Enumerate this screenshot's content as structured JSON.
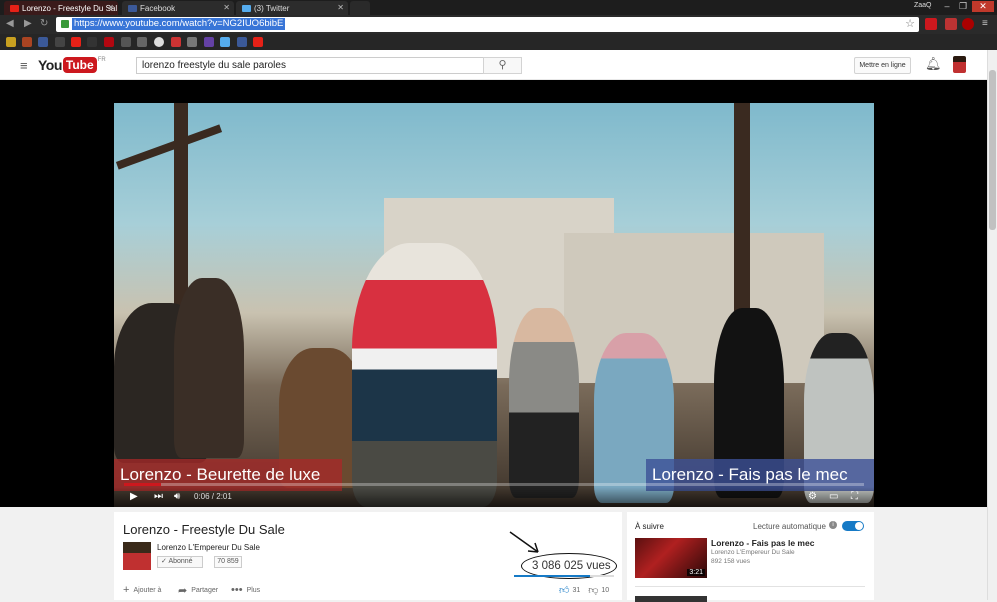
{
  "browser": {
    "tabs": [
      {
        "title": "Lorenzo - Freestyle Du Sal",
        "favicon_color": "#e62117"
      },
      {
        "title": "Facebook",
        "favicon_color": "#3b5998"
      },
      {
        "title": "(3) Twitter",
        "favicon_color": "#55acee"
      }
    ],
    "profile_name": "ZaaQ",
    "url": "https://www.youtube.com/watch?v=NG2IUO6bibE",
    "window_controls": {
      "minimize": "–",
      "restore": "❐",
      "close": "✕"
    }
  },
  "youtube": {
    "logo_you": "You",
    "logo_tube": "Tube",
    "logo_region": "FR",
    "search_query": "lorenzo freestyle du sale paroles",
    "upload_label": "Mettre en ligne"
  },
  "player": {
    "endcard_left": "Lorenzo - Beurette de luxe",
    "endcard_right": "Lorenzo - Fais pas le mec",
    "time": "0:06 / 2:01",
    "progress": 0.05
  },
  "video": {
    "title": "Lorenzo - Freestyle Du Sale",
    "channel": "Lorenzo L'Empereur Du Sale",
    "subscribe_label": "Abonné",
    "subscriber_count": "70 859",
    "views": "3 086 025 vues",
    "like_ratio": 0.76,
    "likes": "31",
    "dislikes": "10",
    "actions": {
      "add": "Ajouter à",
      "share": "Partager",
      "more": "Plus"
    }
  },
  "sidebar": {
    "up_next_label": "À suivre",
    "autoplay_label": "Lecture automatique",
    "autoplay_on": true,
    "next_video": {
      "title": "Lorenzo - Fais pas le mec",
      "channel": "Lorenzo L'Empereur Du Sale",
      "views": "892 158 vues",
      "duration": "3:21"
    }
  },
  "colors": {
    "youtube_red": "#cc181e",
    "link_blue": "#167ac6",
    "url_highlight": "#3875d7"
  }
}
